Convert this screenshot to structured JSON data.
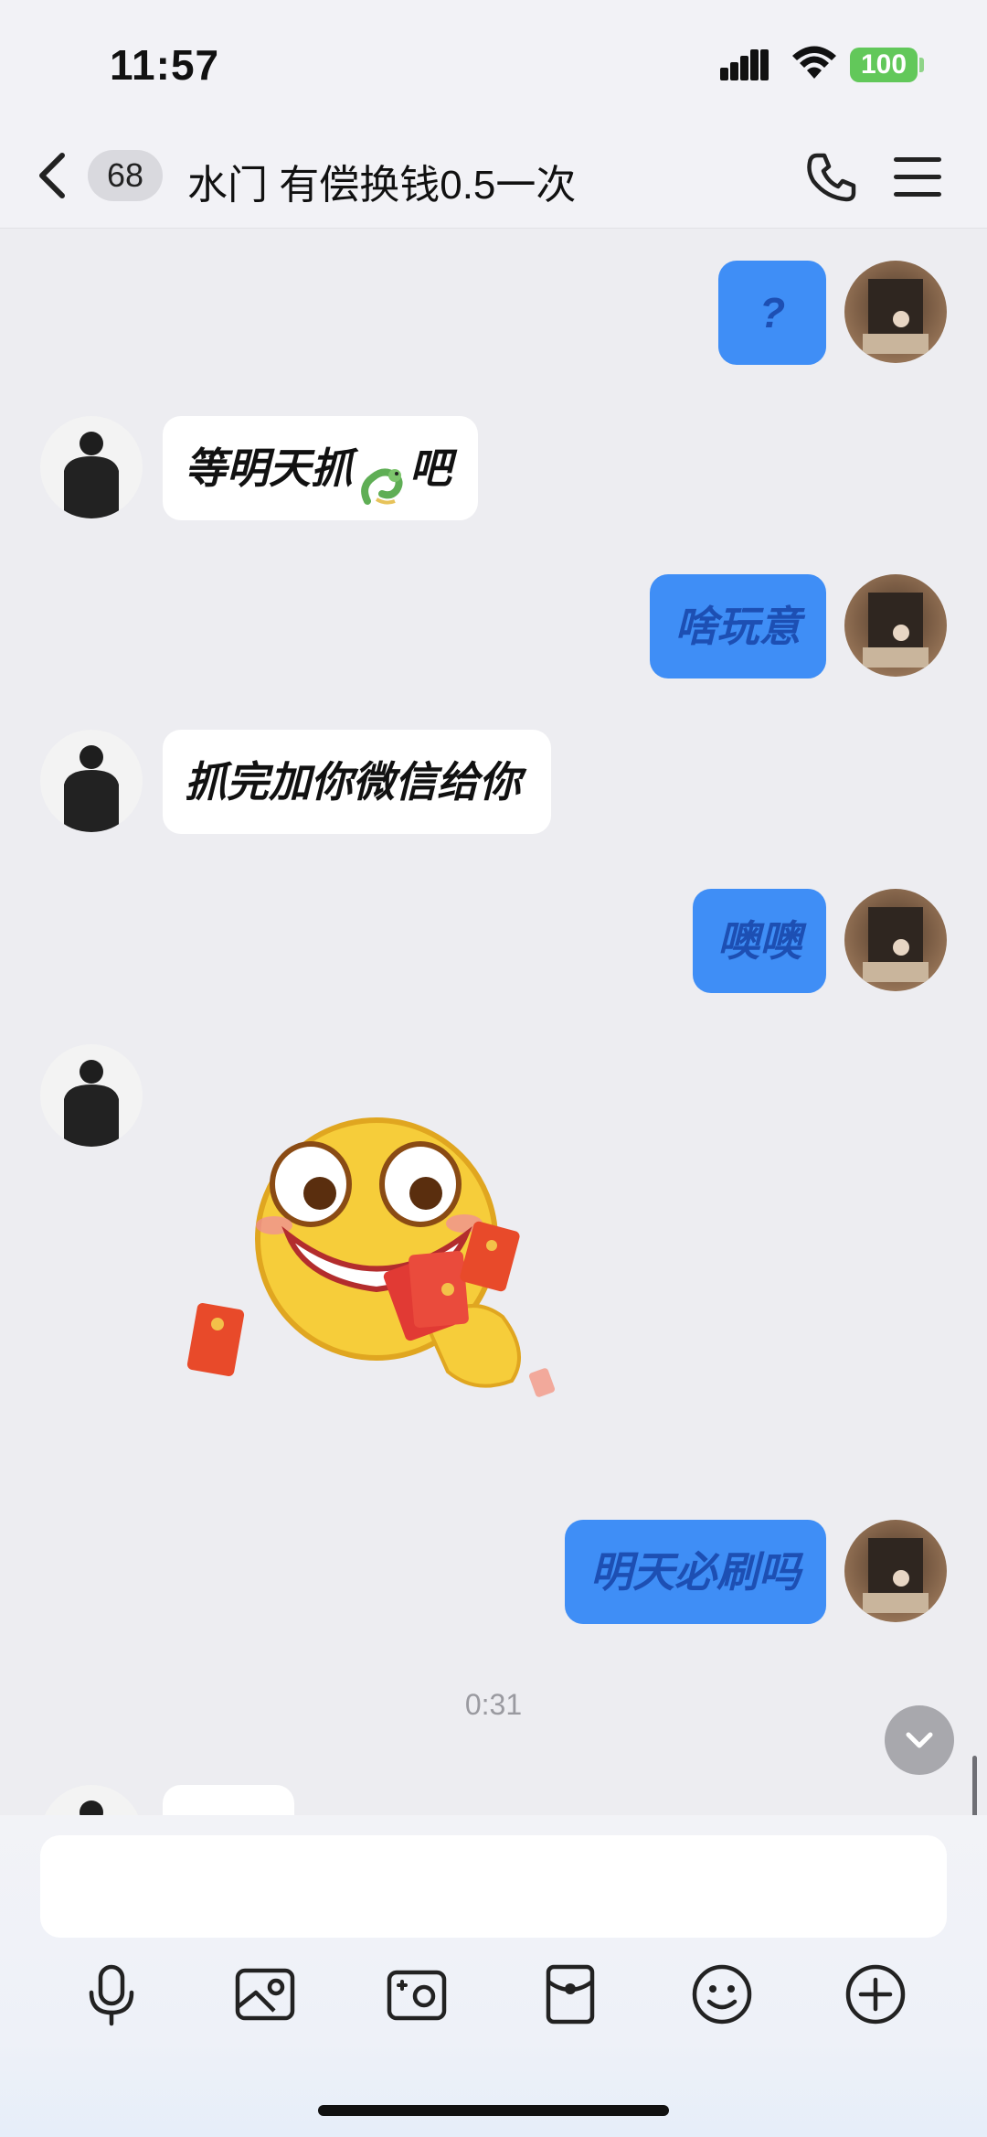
{
  "status_bar": {
    "time": "11:57",
    "battery": "100"
  },
  "header": {
    "unread_count": "68",
    "title": "水门 有偿换钱0.5一次"
  },
  "messages": [
    {
      "side": "me",
      "text": "?"
    },
    {
      "side": "other",
      "text": "等明天抓",
      "emoji": "dragon",
      "text_after": "吧"
    },
    {
      "side": "me",
      "text": "啥玩意"
    },
    {
      "side": "other",
      "text": "抓完加你微信给你"
    },
    {
      "side": "me",
      "text": "噢噢"
    },
    {
      "side": "other",
      "type": "sticker",
      "sticker": "money-grinning-face-with-red-envelopes"
    },
    {
      "side": "me",
      "text": "明天必刷吗"
    }
  ],
  "timestamp": "0:31",
  "input": {
    "placeholder": ""
  },
  "toolbar": [
    "microphone-icon",
    "image-icon",
    "camera-icon",
    "red-envelope-icon",
    "emoji-icon",
    "plus-icon"
  ],
  "colors": {
    "my_bubble": "#3f8ef6",
    "my_text": "#1d4fb3",
    "other_bubble": "#ffffff",
    "background": "#ededf1",
    "battery": "#62c85a"
  }
}
